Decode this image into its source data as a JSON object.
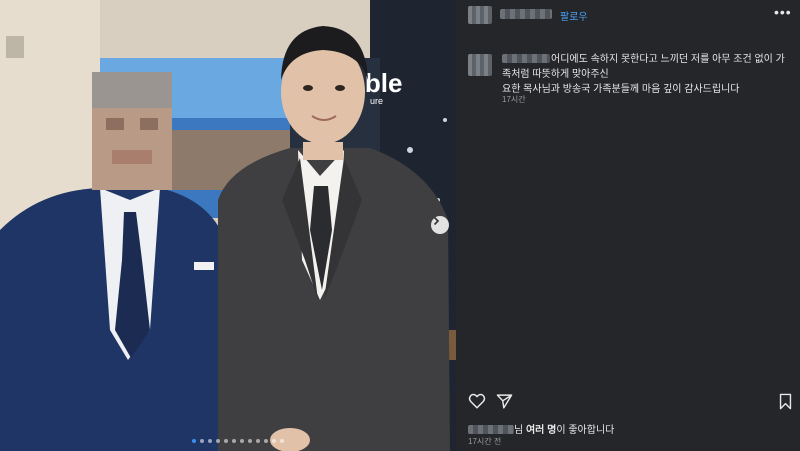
{
  "header": {
    "follow_label": "팔로우",
    "more_label": "•••"
  },
  "caption": {
    "text_line1": "어디에도 속하지 못한다고 느끼던 저를 아무 조건 없이 가족처럼 따뜻하게 맞아주신",
    "text_line2": "요한 목사님과 방송국 가족분들께 마음 깊이 감사드립니다",
    "time": "17시간"
  },
  "photo": {
    "poster_text": "sTable",
    "poster_subtext": "ure",
    "carousel_dots": 12,
    "active_dot": 0
  },
  "likes": {
    "suffix_1": "님 ",
    "bold": "여러 명",
    "suffix_2": "이 좋아합니다",
    "time": "17시간 전"
  },
  "colors": {
    "panel_bg": "#24262a",
    "follow_blue": "#4aa3f5",
    "suit_navy": "#1f3566",
    "suit_gray": "#3f3f42"
  },
  "icons": [
    "chevron-right-icon",
    "heart-icon",
    "share-icon",
    "bookmark-icon"
  ]
}
